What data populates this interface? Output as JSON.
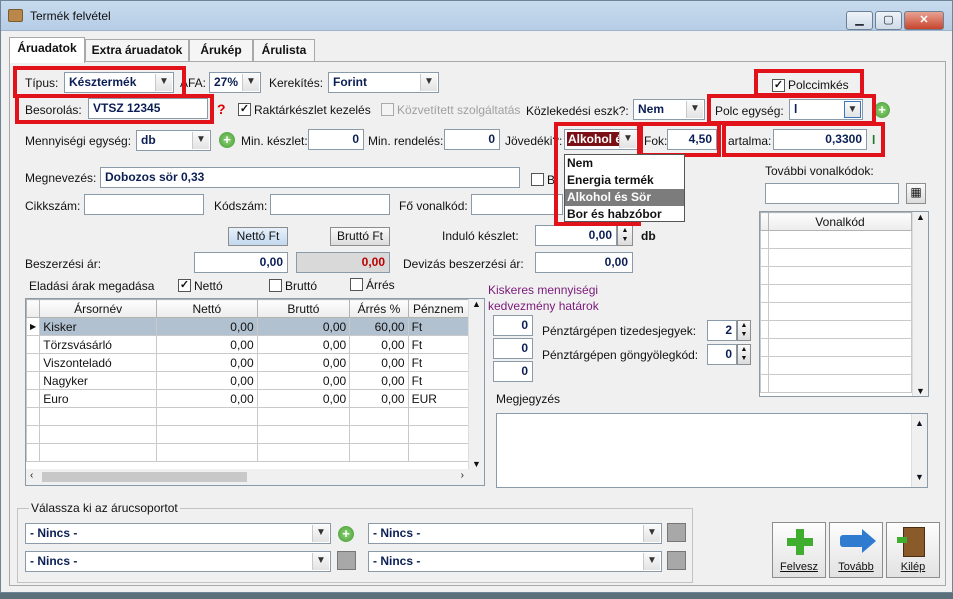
{
  "window": {
    "title": "Termék felvétel",
    "min": "▁",
    "max": "▢",
    "close": "✕"
  },
  "tabs": [
    "Áruadatok",
    "Extra áruadatok",
    "Árukép",
    "Árulista"
  ],
  "form": {
    "tipus_label": "Típus:",
    "tipus_value": "Késztermék",
    "afa_label": "ÁFA:",
    "afa_value": "27%",
    "kerekites_label": "Kerekítés:",
    "kerekites_value": "Forint",
    "polccimkes_label": "Polccimkés",
    "besorolas_label": "Besorolás:",
    "besorolas_value": "VTSZ 12345",
    "besorolas_help": "?",
    "raktar_label": "Raktárkészlet kezelés",
    "kozvetitett_label": "Közvetített szolgáltatás",
    "kozlekedesi_label": "Közlekedési eszk?:",
    "kozlekedesi_value": "Nem",
    "polc_label": "Polc egység:",
    "polc_value": "l",
    "menny_label": "Mennyiségi egység:",
    "menny_value": "db",
    "minkeszlet_label": "Min. készlet:",
    "minkeszlet_value": "0",
    "minrendeles_label": "Min. rendelés:",
    "minrendeles_value": "0",
    "jovedeki_label": "Jövedéki?:",
    "jovedeki_value": "Alkohol é",
    "fok_label": "Fok:",
    "fok_value": "4,50",
    "tartalma_label": "artalma:",
    "tartalma_value": "0,3300",
    "tartalma_unit": "l",
    "megnevezes_label": "Megnevezés:",
    "megnevezes_value": "Dobozos sör 0,33",
    "b_label": "B",
    "cikkszam_label": "Cikkszám:",
    "kodszam_label": "Kódszám:",
    "fovonal_label": "Fő vonalkód:",
    "tovabbi_label": "További vonalkódok:",
    "netto_ft": "Nettó Ft",
    "brutto_ft": "Bruttó Ft",
    "indulo_label": "Induló készlet:",
    "indulo_value": "0,00",
    "indulo_unit": "db",
    "beszerzesi_label": "Beszerzési ár:",
    "beszerzesi_netto": "0,00",
    "beszerzesi_brutto": "0,00",
    "devizas_label": "Devizás beszerzési ár:",
    "devizas_value": "0,00",
    "eladasi_label": "Eladási árak megadása",
    "netto_chk": "Nettó",
    "brutto_chk": "Bruttó",
    "arres_chk": "Árrés",
    "kiskeres_label": "Kiskeres mennyiségi kedvezmény  határok",
    "kiskeres_values": [
      "0",
      "0",
      "0"
    ],
    "tizedes_label": "Pénztárgépen tizedesjegyek:",
    "tizedes_value": "2",
    "gongy_label": "Pénztárgépen göngyölegkód:",
    "gongy_value": "0",
    "megjegyzes_label": "Megjegyzés",
    "arucsoport_label": "Válassza ki az árucsoportot",
    "group_values": [
      "- Nincs -",
      "- Nincs -",
      "- Nincs -",
      "- Nincs -"
    ]
  },
  "jovedeki_options": [
    "Nem",
    "Energia termék",
    "Alkohol és Sör",
    "Bor és habzóbor"
  ],
  "price_table": {
    "headers": [
      "Ársornév",
      "Nettó",
      "Bruttó",
      "Árrés %",
      "Pénznem"
    ],
    "rows": [
      [
        "Kisker",
        "0,00",
        "0,00",
        "60,00",
        "Ft"
      ],
      [
        "Törzsvásárló",
        "0,00",
        "0,00",
        "0,00",
        "Ft"
      ],
      [
        "Viszonteladó",
        "0,00",
        "0,00",
        "0,00",
        "Ft"
      ],
      [
        "Nagyker",
        "0,00",
        "0,00",
        "0,00",
        "Ft"
      ],
      [
        "Euro",
        "0,00",
        "0,00",
        "0,00",
        "EUR"
      ]
    ]
  },
  "barcode_table": {
    "header": "Vonalkód"
  },
  "actions": {
    "felvesz": "Felvesz",
    "tovabb": "Tovább",
    "kilep": "Kilép"
  }
}
